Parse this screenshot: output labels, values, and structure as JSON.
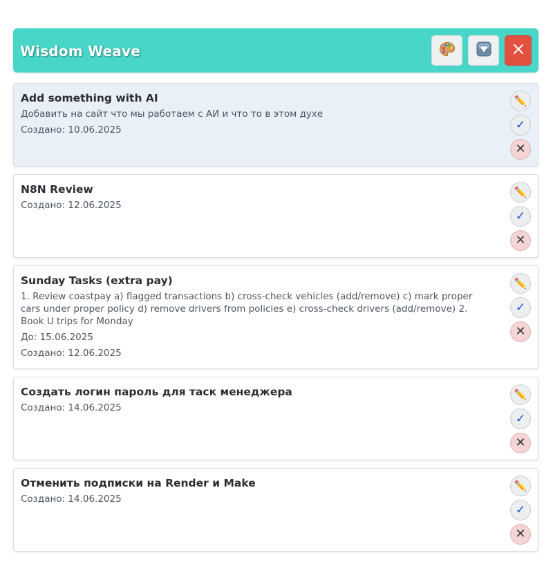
{
  "app": {
    "title": "Wisdom Weave",
    "buttons": {
      "theme_icon": "palette-icon",
      "filter_icon": "filter-down-icon",
      "close_icon": "close-icon"
    },
    "colors": {
      "header": "#48d6c9",
      "close": "#e25140",
      "highlight_card": "#eaf0f8",
      "delete_button": "#f4d4d4"
    }
  },
  "tasks": [
    {
      "title": "Add something with AI",
      "description": "Добавить на сайт что мы работаем с АИ и что то в этом духе",
      "created": "Создано: 10.06.2025"
    },
    {
      "title": "N8N Review",
      "created": "Создано: 12.06.2025"
    },
    {
      "title": "Sunday Tasks (extra pay)",
      "description": "1. Review coastpay a) flagged transactions b) cross-check vehicles (add/remove) c) mark proper cars under proper policy d) remove drivers from policies e) cross-check drivers (add/remove) 2. Book U trips for Monday",
      "due": "До: 15.06.2025",
      "created": "Создано: 12.06.2025"
    },
    {
      "title": "Создать логин пароль для таск менеджера",
      "created": "Создано: 14.06.2025"
    },
    {
      "title": "Отменить подписки на Render и Make",
      "created": "Создано: 14.06.2025"
    }
  ],
  "actions": {
    "edit_icon": "pencil-icon",
    "complete_icon": "check-icon",
    "delete_icon": "x-icon"
  }
}
